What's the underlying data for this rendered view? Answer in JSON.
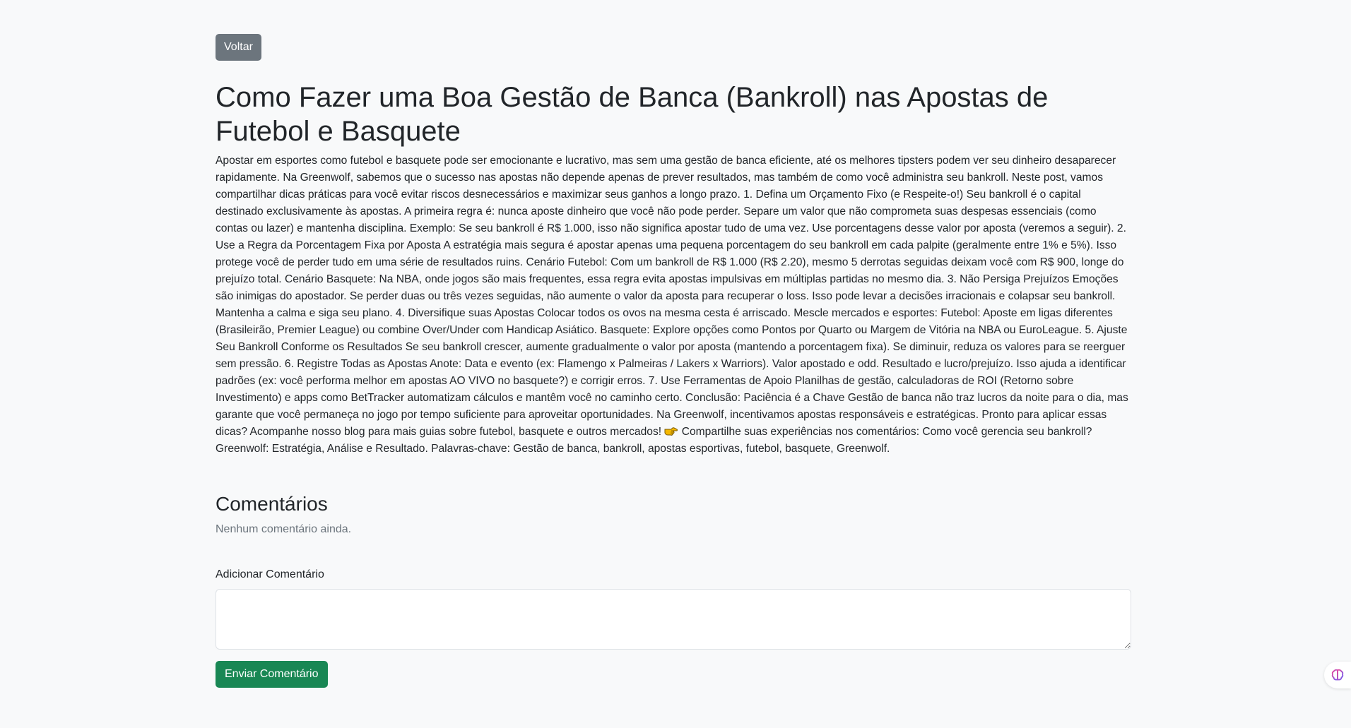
{
  "nav": {
    "back_label": "Voltar"
  },
  "post": {
    "title": "Como Fazer uma Boa Gestão de Banca (Bankroll) nas Apostas de Futebol e Basquete",
    "body_part1": "Apostar em esportes como futebol e basquete pode ser emocionante e lucrativo, mas sem uma gestão de banca eficiente, até os melhores tipsters podem ver seu dinheiro desaparecer rapidamente. Na Greenwolf, sabemos que o sucesso nas apostas não depende apenas de prever resultados, mas também de como você administra seu bankroll. Neste post, vamos compartilhar dicas práticas para você evitar riscos desnecessários e maximizar seus ganhos a longo prazo. 1. Defina um Orçamento Fixo (e Respeite-o!) Seu bankroll é o capital destinado exclusivamente às apostas. A primeira regra é: nunca aposte dinheiro que você não pode perder. Separe um valor que não comprometa suas despesas essenciais (como contas ou lazer) e mantenha disciplina. Exemplo: Se seu bankroll é R$ 1.000, isso não significa apostar tudo de uma vez. Use porcentagens desse valor por aposta (veremos a seguir). 2. Use a Regra da Porcentagem Fixa por Aposta A estratégia mais segura é apostar apenas uma pequena porcentagem do seu bankroll em cada palpite (geralmente entre 1% e 5%). Isso protege você de perder tudo em uma série de resultados ruins. Cenário Futebol: Com um bankroll de R$ 1.000 (R$ 2.20), mesmo 5 derrotas seguidas deixam você com R$ 900, longe do prejuízo total. Cenário Basquete: Na NBA, onde jogos são mais frequentes, essa regra evita apostas impulsivas em múltiplas partidas no mesmo dia. 3. Não Persiga Prejuízos Emoções são inimigas do apostador. Se perder duas ou três vezes seguidas, não aumente o valor da aposta para recuperar o loss. Isso pode levar a decisões irracionais e colapsar seu bankroll. Mantenha a calma e siga seu plano. 4. Diversifique suas Apostas Colocar todos os ovos na mesma cesta é arriscado. Mescle mercados e esportes: Futebol: Aposte em ligas diferentes (Brasileirão, Premier League) ou combine Over/Under com Handicap Asiático. Basquete: Explore opções como Pontos por Quarto ou Margem de Vitória na NBA ou EuroLeague. 5. Ajuste Seu Bankroll Conforme os Resultados Se seu bankroll crescer, aumente gradualmente o valor por aposta (mantendo a porcentagem fixa). Se diminuir, reduza os valores para se reerguer sem pressão. 6. Registre Todas as Apostas Anote: Data e evento (ex: Flamengo x Palmeiras / Lakers x Warriors). Valor apostado e odd. Resultado e lucro/prejuízo. Isso ajuda a identificar padrões (ex: você performa melhor em apostas AO VIVO no basquete?) e corrigir erros. 7. Use Ferramentas de Apoio Planilhas de gestão, calculadoras de ROI (Retorno sobre Investimento) e apps como BetTracker automatizam cálculos e mantêm você no caminho certo. Conclusão: Paciência é a Chave Gestão de banca não traz lucros da noite para o dia, mas garante que você permaneça no jogo por tempo suficiente para aproveitar oportunidades. Na Greenwolf, incentivamos apostas responsáveis e estratégicas. Pronto para aplicar essas dicas? Acompanhe nosso blog para mais guias sobre futebol, basquete e outros mercados! ",
    "emoji_icon": "pointing-hand-icon",
    "body_part2": " Compartilhe suas experiências nos comentários: Como você gerencia seu bankroll? Greenwolf: Estratégia, Análise e Resultado. Palavras-chave: Gestão de banca, bankroll, apostas esportivas, futebol, basquete, Greenwolf."
  },
  "comments": {
    "title": "Comentários",
    "empty_text": "Nenhum comentário ainda.",
    "form_label": "Adicionar Comentário",
    "textarea_value": "",
    "textarea_placeholder": "",
    "submit_label": "Enviar Comentário"
  },
  "colors": {
    "background": "#f8f9fa",
    "back_button": "#6c757d",
    "submit_button": "#198754",
    "muted_text": "#6c757d"
  },
  "widget": {
    "icon": "brain-extension-icon"
  }
}
